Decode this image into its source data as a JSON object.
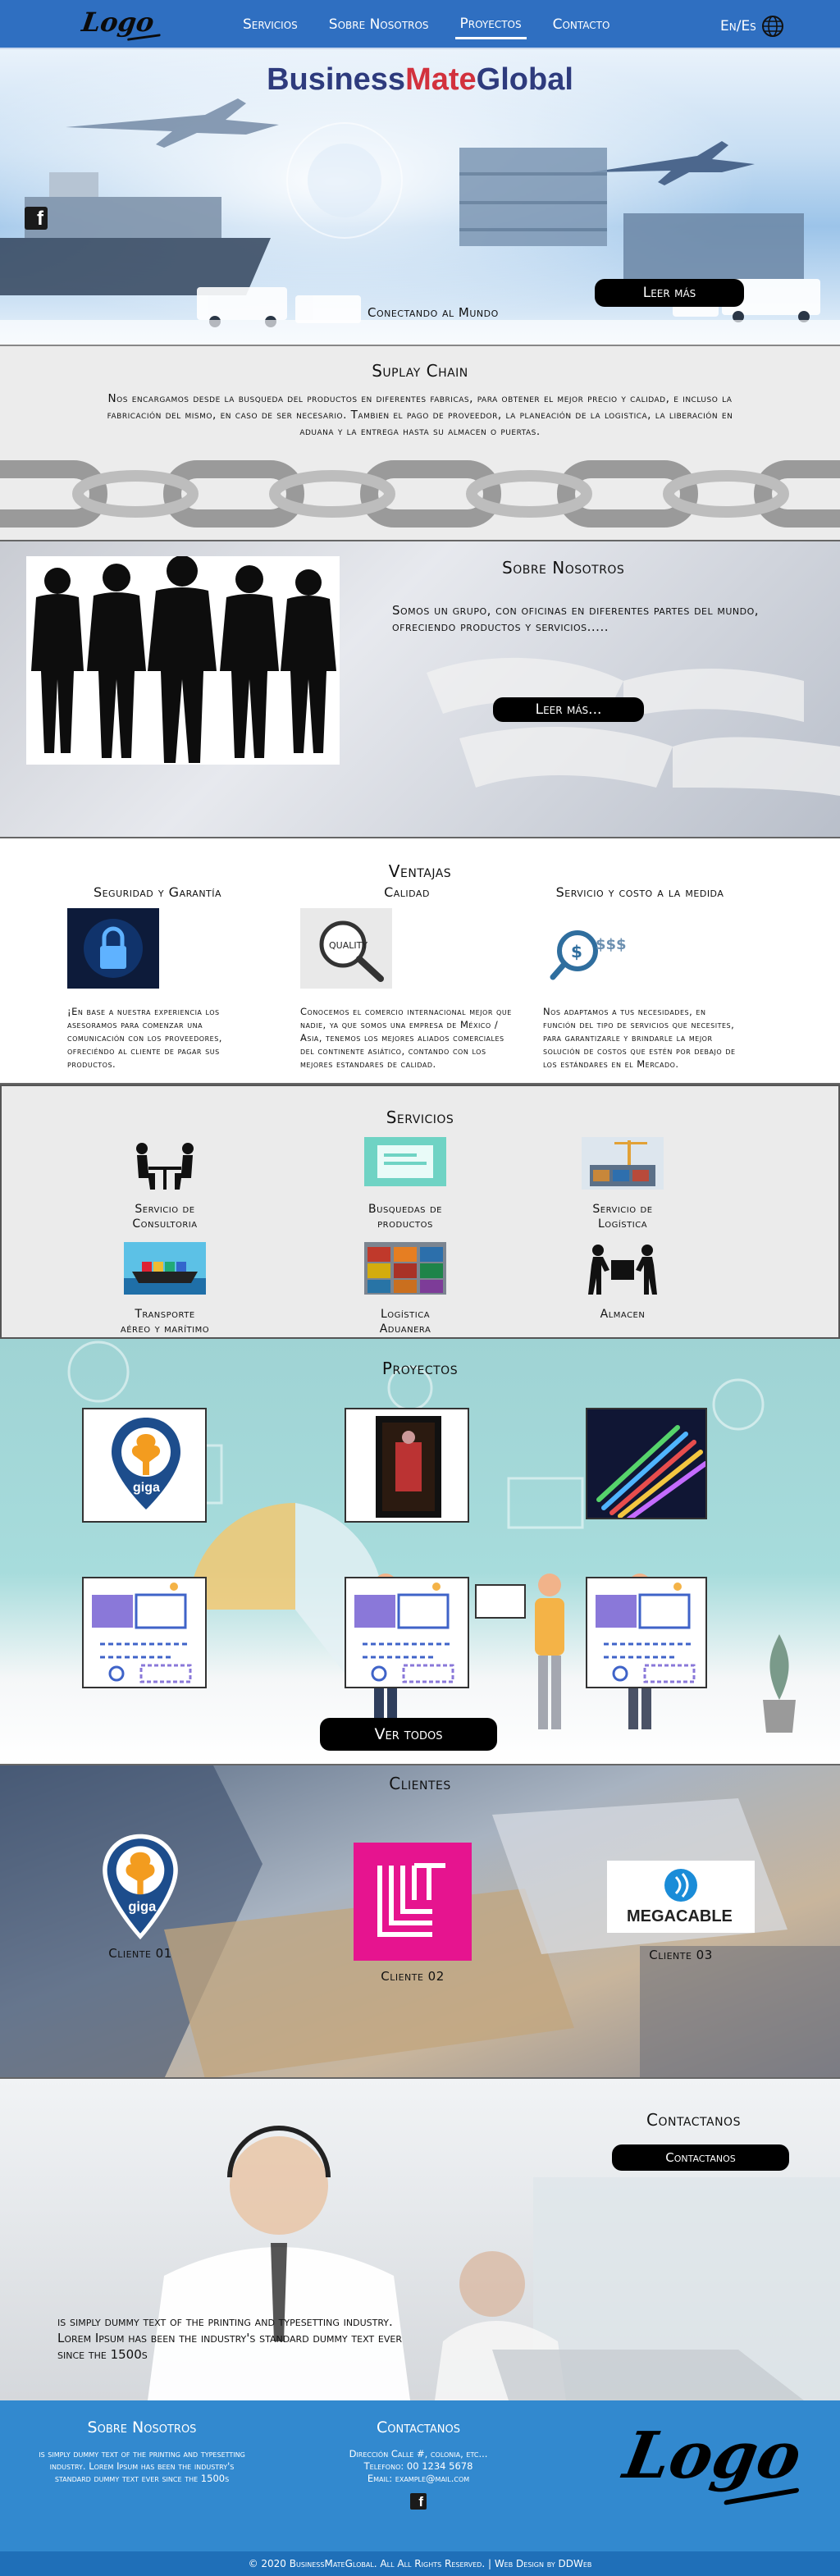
{
  "nav": {
    "logo": "Logo",
    "links": [
      "Servicios",
      "Sobre Nosotros",
      "Proyectos",
      "Contacto"
    ],
    "active": "Proyectos",
    "lang": "En/Es"
  },
  "hero": {
    "brand_part1": "Business",
    "brand_part2": "Mate",
    "brand_part3": "Global",
    "tagline": "Conectando al Mundo",
    "button": "Leer más"
  },
  "supply": {
    "title": "Suplay Chain",
    "text": "Nos encargamos desde la busqueda del productos en diferentes fabricas, para obtener el mejor precio y calidad, e incluso la fabricación del mismo, en caso de ser necesario. Tambien el pago de proveedor, la planeación de la logistica, la liberación en aduana y la entrega hasta su almacen o puertas."
  },
  "about": {
    "title": "Sobre Nosotros",
    "text": "Somos un grupo, con oficinas en diferentes partes del mundo, ofreciendo productos y servicios.....",
    "button": "Leer más..."
  },
  "advantages": {
    "title": "Ventajas",
    "items": [
      {
        "title": "Seguridad y Garantía",
        "icon": "padlock-icon",
        "text": "¡En base a nuestra experiencia los asesoramos para comenzar una comunicación con los proveedores, ofreciéndo al cliente de pagar sus productos."
      },
      {
        "title": "Calidad",
        "icon": "magnifier-quality-icon",
        "text": "Conocemos el comercio internacional mejor que nadie, ya que somos una empresa de México / Asia, tenemos los mejores aliados comerciales del continente asiático, contando con los mejores estandares de calidad."
      },
      {
        "title": "Servicio y costo a la medida",
        "icon": "money-search-icon",
        "text": "Nos adaptamos a tus necesidades, en función del tipo de servicios que necesites, para garantizarle y brindarle la mejor solución de costos que estén por debajo de los estándares en el Mercado."
      }
    ]
  },
  "services": {
    "title": "Servicios",
    "items": [
      {
        "label1": "Servicio de",
        "label2": "Consultoria",
        "icon": "consulting-icon"
      },
      {
        "label1": "Busquedas de",
        "label2": "productos",
        "icon": "product-search-icon"
      },
      {
        "label1": "Servicio de",
        "label2": "Logística",
        "icon": "logistics-icon"
      },
      {
        "label1": "Transporte",
        "label2": "aéreo y marítimo",
        "icon": "ship-icon"
      },
      {
        "label1": "Logística",
        "label2": "Aduanera",
        "icon": "customs-icon"
      },
      {
        "label1": "Almacen",
        "label2": "",
        "icon": "warehouse-icon"
      }
    ]
  },
  "projects": {
    "title": "Proyectos",
    "button": "Ver todos",
    "giga_text": "giga"
  },
  "clients": {
    "title": "Clientes",
    "items": [
      {
        "label": "Cliente 01",
        "logo": "giga"
      },
      {
        "label": "Cliente 02",
        "logo": "LT"
      },
      {
        "label": "Cliente 03",
        "logo": "MEGACABLE"
      }
    ]
  },
  "contact": {
    "title": "Contactanos",
    "button": "Contactanos",
    "text": "is simply dummy text of the printing and typesetting industry. Lorem Ipsum has been the industry's standard dummy text ever since the 1500s"
  },
  "footer": {
    "about_title": "Sobre Nosotros",
    "about_text": "is simply dummy text of the printing and typesetting industry. Lorem Ipsum has been the industry's standard dummy text ever since the 1500s",
    "contact_title": "Contactanos",
    "address": "Dirección Calle #, colonia, etc...",
    "phone": "Telefono: 00 1234 5678",
    "email": "Email: example@mail.com",
    "logo": "Logo",
    "copyright": "© 2020 BusinessMateGlobal. All All Rights Reserved. | Web Design by DDWeb"
  },
  "colors": {
    "nav": "#2f6fc1",
    "footer": "#3289cf",
    "brand_blue": "#2e3b7d",
    "brand_red": "#d2313d",
    "button": "#000000"
  }
}
